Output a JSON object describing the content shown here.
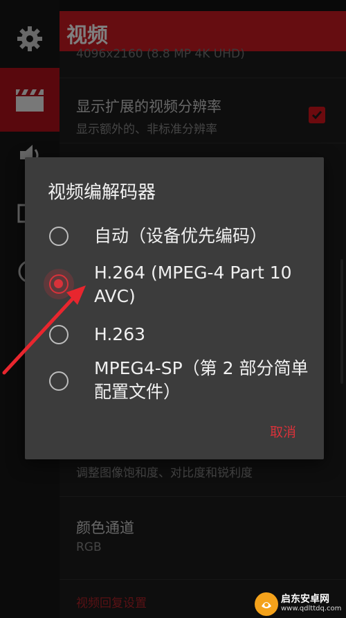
{
  "app_bar": {
    "title": "视频"
  },
  "rail": {
    "items": [
      {
        "icon": "gear-icon"
      },
      {
        "icon": "film-clapper-icon"
      },
      {
        "icon": "speaker-icon"
      },
      {
        "icon": "image-icon"
      },
      {
        "icon": "timer-icon"
      }
    ]
  },
  "settings": {
    "resolution_partial": "4096x2160 (8.8 MP 4K UHD)",
    "extended_resolution": {
      "title": "显示扩展的视频分辨率",
      "subtitle": "显示额外的、非标准分辨率",
      "checked": true
    },
    "image_adjust_subtitle": "调整图像饱和度、对比度和锐利度",
    "color_channel": {
      "title": "颜色通道",
      "value": "RGB"
    },
    "restore_link": "视频回复设置"
  },
  "dialog": {
    "title": "视频编解码器",
    "options": [
      {
        "label": "自动（设备优先编码）",
        "selected": false
      },
      {
        "label": "H.264 (MPEG-4 Part 10 AVC)",
        "selected": true
      },
      {
        "label": "H.263",
        "selected": false
      },
      {
        "label": "MPEG4-SP（第 2 部分简单配置文件）",
        "selected": false
      }
    ],
    "cancel_label": "取消"
  },
  "watermark": {
    "name": "启东安卓网",
    "url": "www.qdlttdq.com"
  },
  "colors": {
    "accent": "#cc1a23",
    "dialog_bg": "#3c3c3c",
    "radio_selected": "#d8323a"
  }
}
